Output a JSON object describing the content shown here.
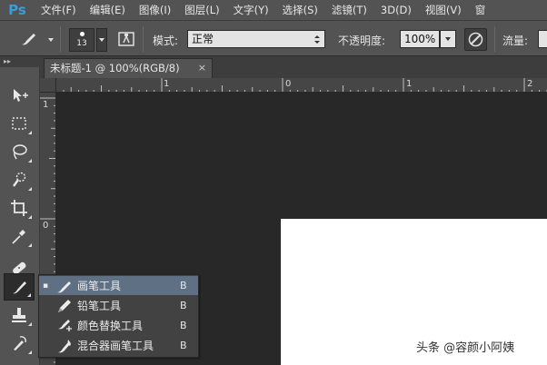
{
  "app": {
    "logo": "Ps",
    "menus": [
      "文件(F)",
      "编辑(E)",
      "图像(I)",
      "图层(L)",
      "文字(Y)",
      "选择(S)",
      "滤镜(T)",
      "3D(D)",
      "视图(V)",
      "窗"
    ]
  },
  "options": {
    "brush_size": "13",
    "mode_label": "模式:",
    "mode_value": "正常",
    "opacity_label": "不透明度:",
    "opacity_value": "100%",
    "flow_label": "流量:"
  },
  "panel": {
    "collapse_glyph": "▸▸"
  },
  "document": {
    "tab_title": "未标题-1 @ 100%(RGB/8)",
    "tab_close": "×",
    "ruler_h_labels": [
      "1",
      "0",
      "1",
      "2"
    ],
    "ruler_v_labels": [
      "1",
      "0"
    ]
  },
  "flyout": {
    "items": [
      {
        "label": "画笔工具",
        "key": "B",
        "selected_marker": "▪",
        "icon": "brush-icon"
      },
      {
        "label": "铅笔工具",
        "key": "B",
        "selected_marker": "",
        "icon": "pencil-icon"
      },
      {
        "label": "颜色替换工具",
        "key": "B",
        "selected_marker": "",
        "icon": "color-replacement-icon"
      },
      {
        "label": "混合器画笔工具",
        "key": "B",
        "selected_marker": "",
        "icon": "mixer-brush-icon"
      }
    ]
  },
  "watermark": "头条 @容颜小阿姨",
  "colors": {
    "menubar": "#535353",
    "canvas_bg": "#282828",
    "flyout_selected": "#5f6f84",
    "logo": "#3b9cd9"
  }
}
